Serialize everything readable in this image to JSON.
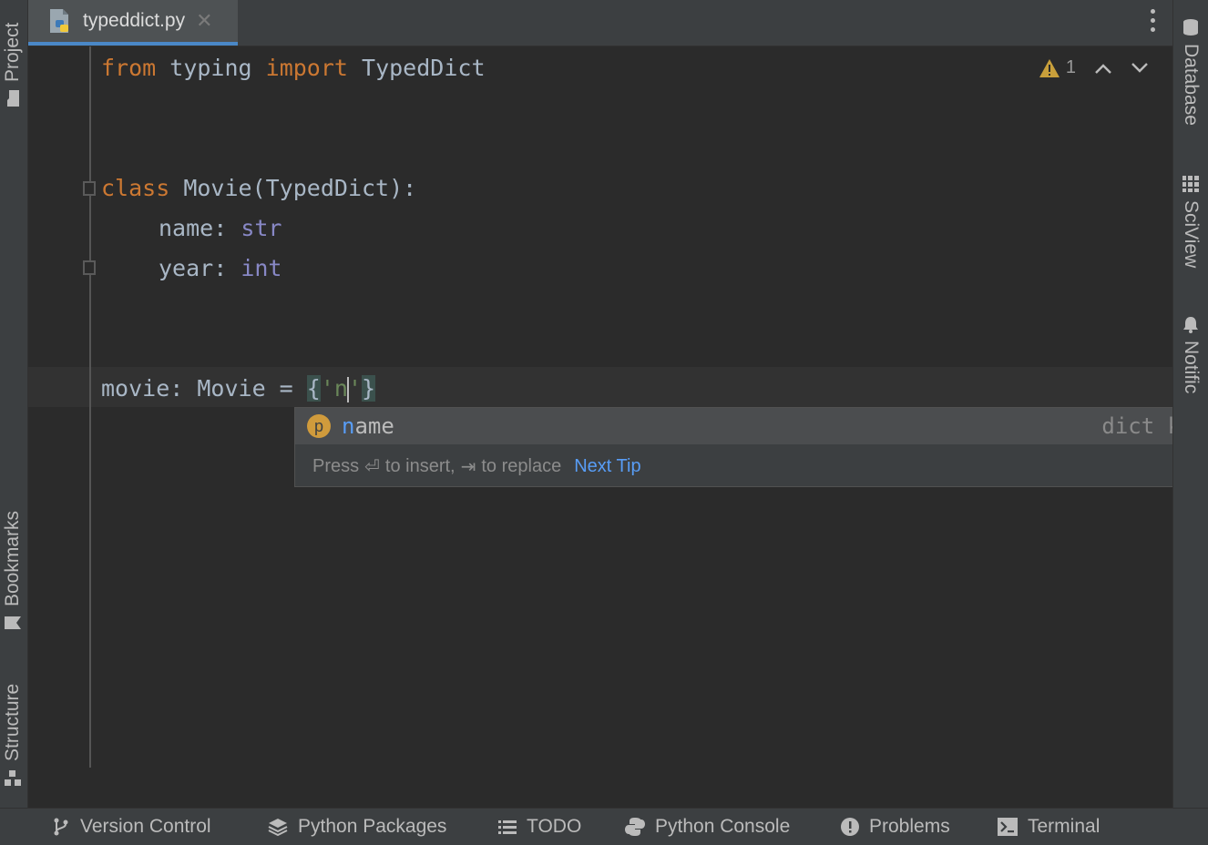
{
  "tab": {
    "filename": "typeddict.py",
    "close_glyph": "✕"
  },
  "left_tools": {
    "project": "Project",
    "bookmarks": "Bookmarks",
    "structure": "Structure"
  },
  "right_tools": {
    "database": "Database",
    "sciview": "SciView",
    "notifications": "Notific"
  },
  "inspections": {
    "warning_count": "1"
  },
  "code": {
    "l1": {
      "kw1": "from",
      "mod": "typing",
      "kw2": "import",
      "name": "TypedDict"
    },
    "l4": {
      "kw": "class",
      "rest": "Movie(TypedDict):"
    },
    "l5": {
      "field": "name: ",
      "type": "str"
    },
    "l6": {
      "field": "year: ",
      "type": "int"
    },
    "l9": {
      "prefix": "movie: Movie = ",
      "open": "{",
      "str_a": "'n",
      "str_b": "'",
      "close": "}"
    }
  },
  "completion": {
    "icon_letter": "p",
    "item_match": "n",
    "item_rest": "ame",
    "item_type": "dict key",
    "hint_press": "Press",
    "hint_enter_glyph": "⏎",
    "hint_insert": "to insert,",
    "hint_tab_glyph": "⇥",
    "hint_replace": "to replace",
    "next_tip": "Next Tip"
  },
  "bottom_tools": {
    "version_control": "Version Control",
    "python_packages": "Python Packages",
    "todo": "TODO",
    "python_console": "Python Console",
    "problems": "Problems",
    "terminal": "Terminal"
  },
  "colors": {
    "keyword": "#cc7832",
    "builtin": "#8888c6",
    "string": "#6a8759",
    "accent": "#4a88c7",
    "match": "#589df6"
  }
}
